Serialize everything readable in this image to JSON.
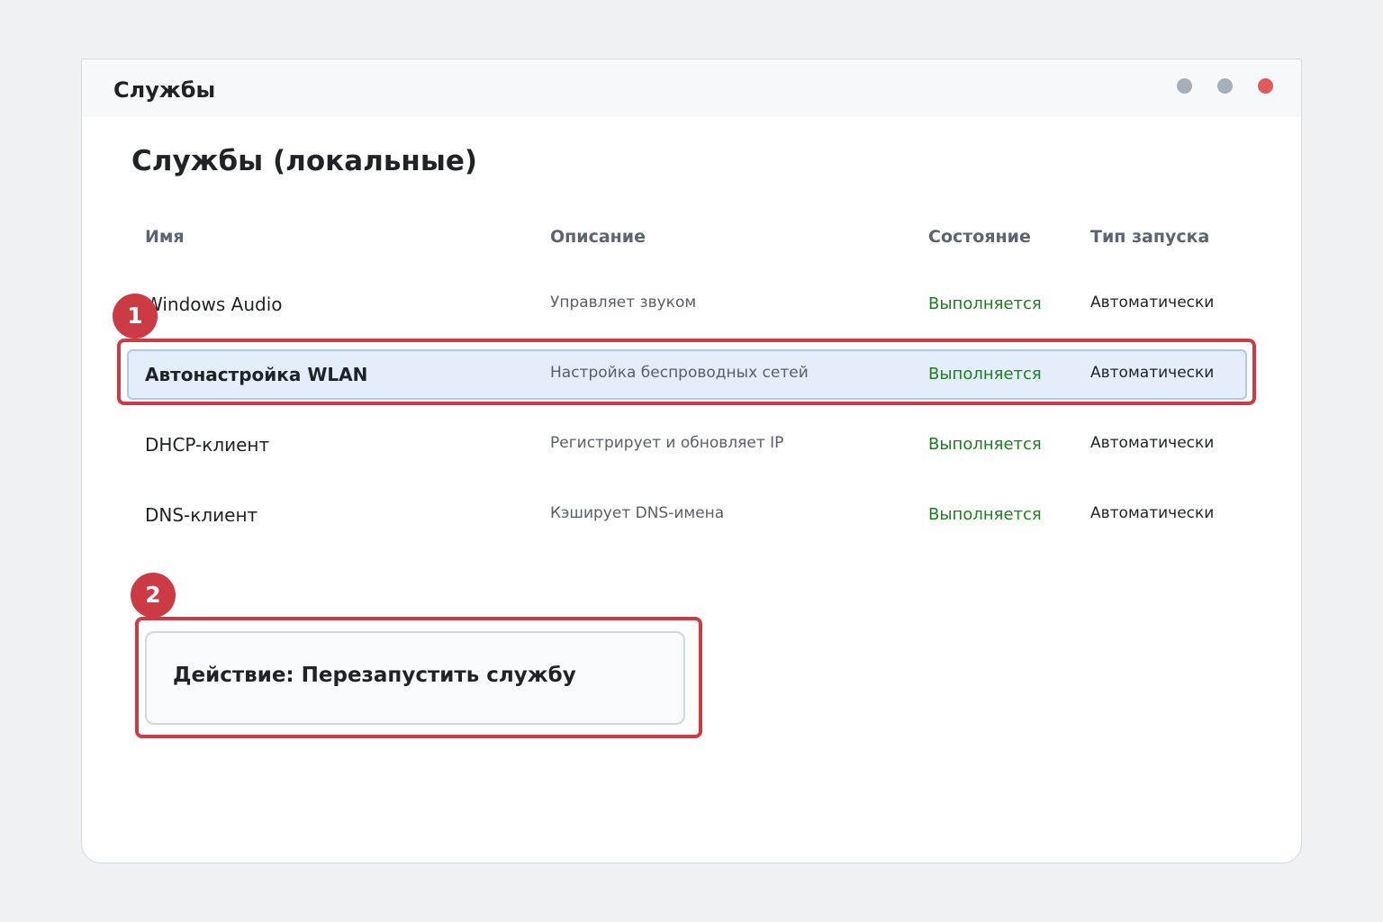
{
  "window": {
    "title": "Службы"
  },
  "page": {
    "title": "Службы (локальные)"
  },
  "columns": {
    "name": "Имя",
    "description": "Описание",
    "state": "Состояние",
    "startup": "Тип запуска"
  },
  "services": [
    {
      "name": "Windows Audio",
      "description": "Управляет звуком",
      "state": "Выполняется",
      "startup": "Автоматически",
      "selected": false
    },
    {
      "name": "Автонастройка WLAN",
      "description": "Настройка беспроводных сетей",
      "state": "Выполняется",
      "startup": "Автоматически",
      "selected": true
    },
    {
      "name": "DHCP-клиент",
      "description": "Регистрирует и обновляет IP",
      "state": "Выполняется",
      "startup": "Автоматически",
      "selected": false
    },
    {
      "name": "DNS-клиент",
      "description": "Кэширует DNS-имена",
      "state": "Выполняется",
      "startup": "Автоматически",
      "selected": false
    }
  ],
  "action": {
    "label": "Действие: Перезапустить службу"
  },
  "annotations": {
    "marker_1": "1",
    "marker_2": "2"
  },
  "colors": {
    "state_running": "#1e7d1e",
    "annotation": "#cc3b44",
    "selected_row": "#e3eefa",
    "window_close": "#e05a5a",
    "window_control": "#a6afb9"
  }
}
